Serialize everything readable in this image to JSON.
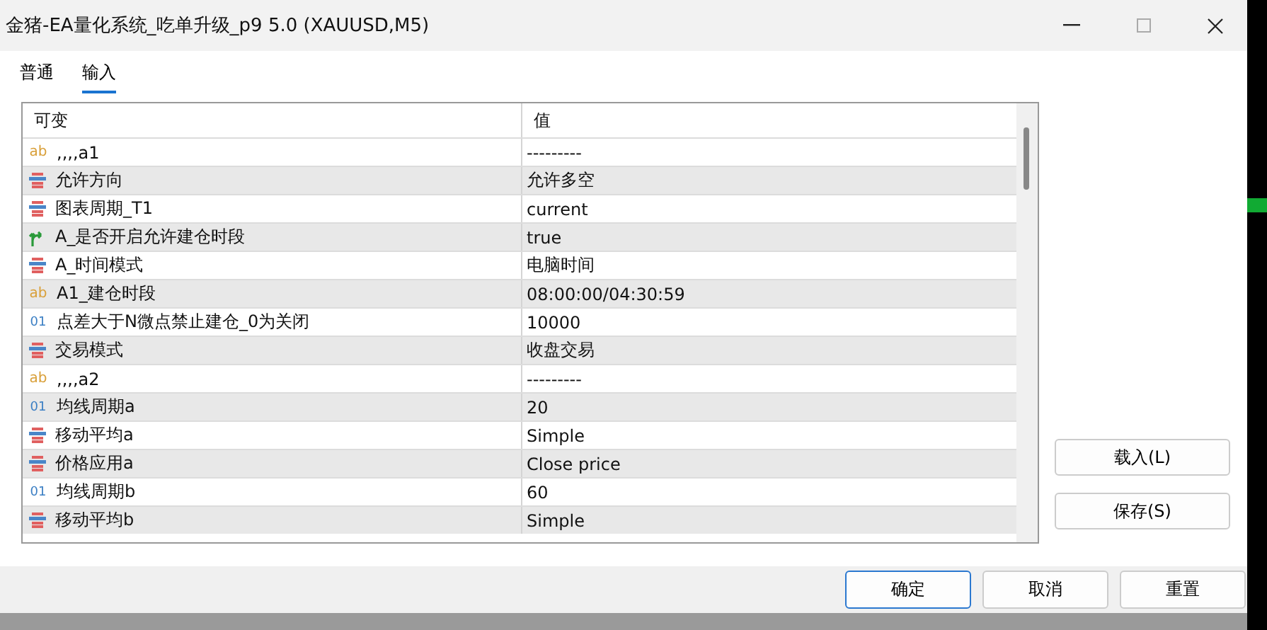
{
  "window": {
    "title": "金猪-EA量化系统_吃单升级_p9 5.0 (XAUUSD,M5)"
  },
  "tabs": [
    {
      "label": "普通",
      "selected": false
    },
    {
      "label": "输入",
      "selected": true
    }
  ],
  "table": {
    "columns": [
      "可变",
      "值"
    ],
    "rows": [
      {
        "kind": "string",
        "icon": "ab",
        "name": ",,,,a1",
        "value": "---------"
      },
      {
        "kind": "enum",
        "name": "允许方向",
        "value": "允许多空"
      },
      {
        "kind": "enum",
        "name": "图表周期_T1",
        "value": "current"
      },
      {
        "kind": "bool",
        "name": "A_是否开启允许建仓时段",
        "value": "true"
      },
      {
        "kind": "enum",
        "name": "A_时间模式",
        "value": "电脑时间"
      },
      {
        "kind": "string",
        "icon": "ab",
        "name": "A1_建仓时段",
        "value": "08:00:00/04:30:59"
      },
      {
        "kind": "int",
        "icon": "01",
        "name": "点差大于N微点禁止建仓_0为关闭",
        "value": "10000"
      },
      {
        "kind": "enum",
        "name": "交易模式",
        "value": "收盘交易"
      },
      {
        "kind": "string",
        "icon": "ab",
        "name": ",,,,a2",
        "value": "---------"
      },
      {
        "kind": "int",
        "icon": "01",
        "name": "均线周期a",
        "value": "20"
      },
      {
        "kind": "enum",
        "name": "移动平均a",
        "value": "Simple"
      },
      {
        "kind": "enum",
        "name": "价格应用a",
        "value": "Close price"
      },
      {
        "kind": "int",
        "icon": "01",
        "name": "均线周期b",
        "value": "60"
      },
      {
        "kind": "enum",
        "name": "移动平均b",
        "value": "Simple"
      }
    ]
  },
  "side_buttons": [
    {
      "label": "载入(L)"
    },
    {
      "label": "保存(S)"
    }
  ],
  "buttons": [
    {
      "label": "确定",
      "selected": true
    },
    {
      "label": "取消",
      "selected": false
    },
    {
      "label": "重置",
      "selected": false
    }
  ]
}
